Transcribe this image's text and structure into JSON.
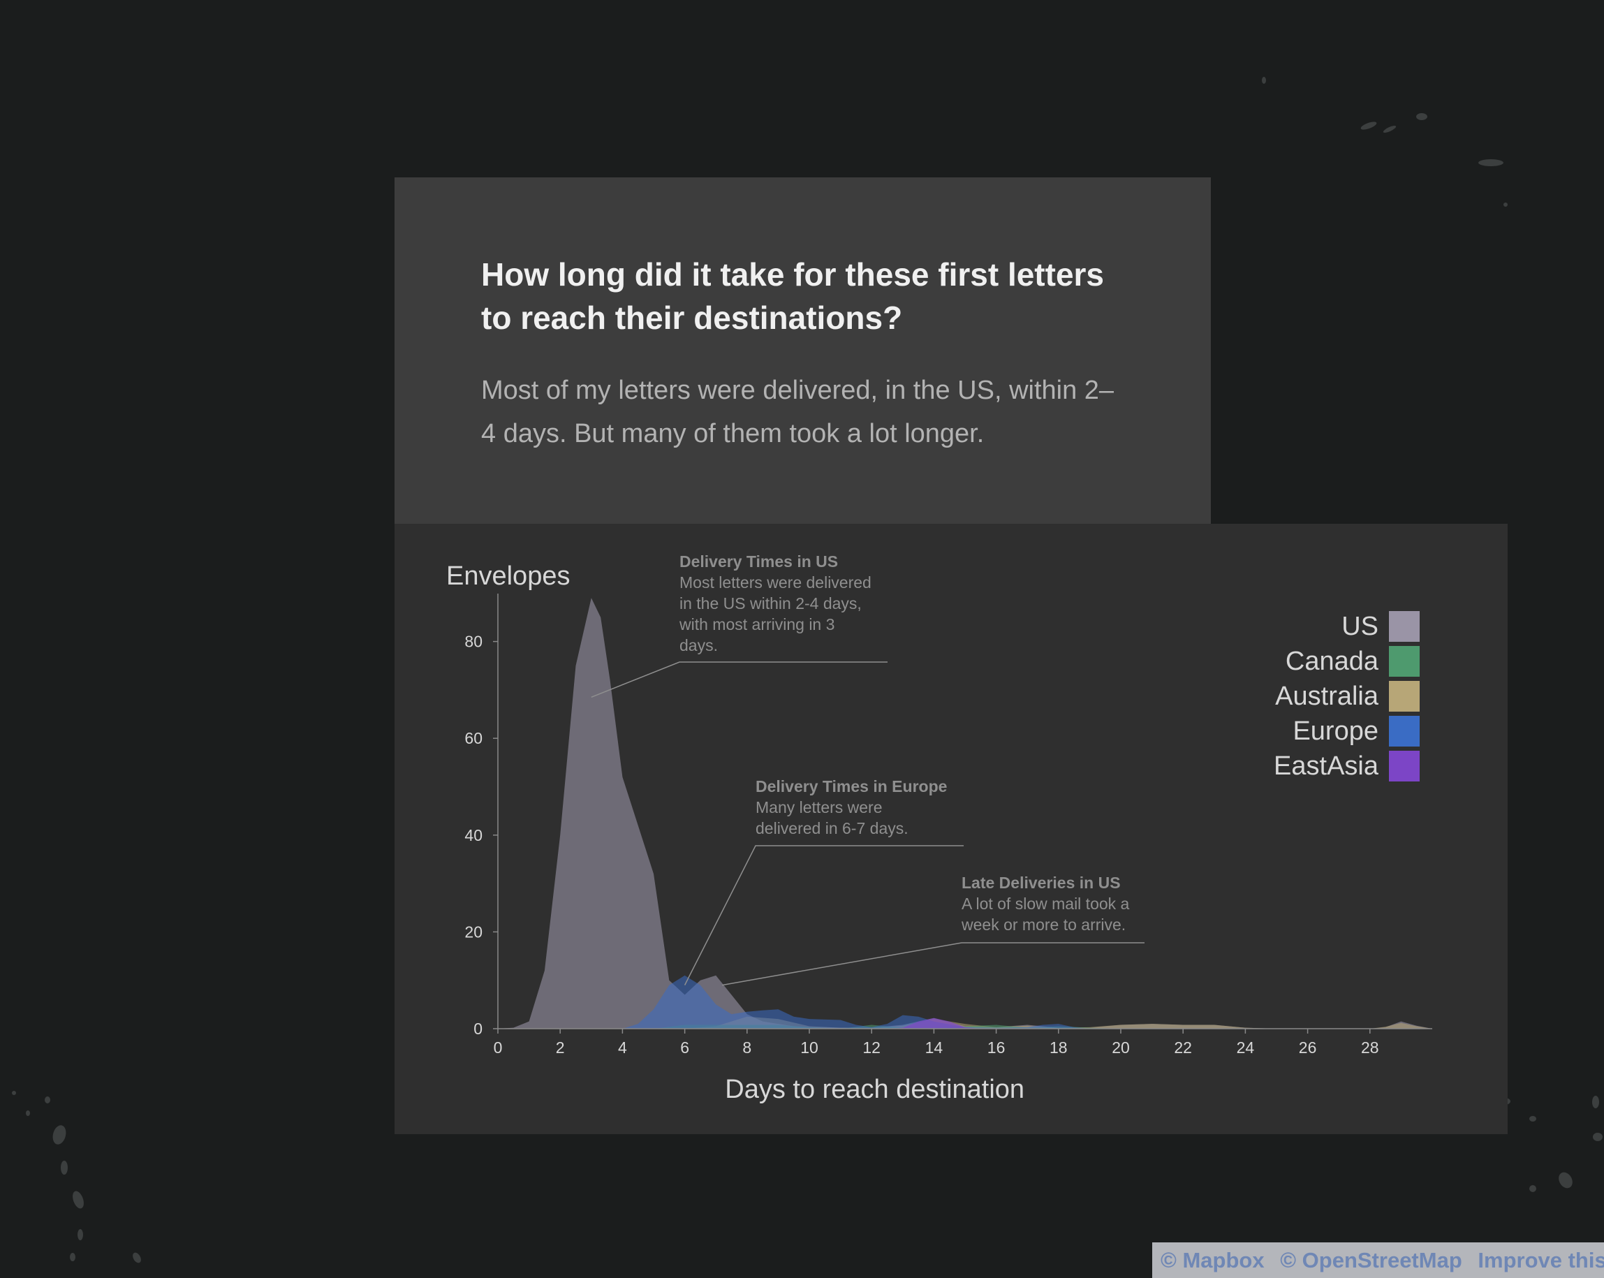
{
  "intro": {
    "title": "How long did it take for these first letters to reach their destinations?",
    "text": "Most of my letters were delivered, in the US, within 2–4 days. But many of them took a lot longer."
  },
  "attribution": {
    "mapbox": "© Mapbox",
    "osm": "© OpenStreetMap",
    "improve": "Improve this m"
  },
  "chart_data": {
    "type": "area",
    "ylabel": "Envelopes",
    "xlabel": "Days to reach destination",
    "xlim": [
      0,
      30
    ],
    "ylim": [
      0,
      90
    ],
    "xticks": [
      0,
      2,
      4,
      6,
      8,
      10,
      12,
      14,
      16,
      18,
      20,
      22,
      24,
      26,
      28
    ],
    "yticks": [
      0,
      20,
      40,
      60,
      80
    ],
    "legend_position": "top-right",
    "series": [
      {
        "name": "US",
        "color": "#9a94a6",
        "x": [
          0,
          0.5,
          1,
          1.5,
          2,
          2.5,
          3,
          3.3,
          3.6,
          4,
          4.5,
          5,
          5.5,
          6,
          6.5,
          7,
          7.5,
          8,
          8.5,
          9,
          9.5,
          10,
          11,
          12,
          13,
          14,
          15,
          16,
          17,
          18,
          19,
          20,
          21,
          22,
          23,
          24,
          25,
          26,
          27,
          28,
          28.5,
          29,
          29.5,
          30
        ],
        "y": [
          0,
          0.2,
          1.5,
          12,
          40,
          75,
          89,
          85,
          72,
          52,
          42,
          32,
          10,
          7,
          10,
          11,
          7,
          3,
          1.5,
          1,
          0.5,
          0.3,
          0.2,
          0.2,
          0.8,
          2.2,
          0.5,
          0.3,
          0.8,
          0.2,
          0.2,
          0.8,
          1,
          0.8,
          0.8,
          0.2,
          0,
          0,
          0,
          0,
          0.3,
          1.5,
          0.6,
          0
        ]
      },
      {
        "name": "Canada",
        "color": "#4e9a6e",
        "x": [
          0,
          5,
          6,
          7,
          8,
          9,
          10,
          11,
          12,
          13,
          14,
          15,
          16,
          17,
          18,
          19,
          20,
          30
        ],
        "y": [
          0,
          0,
          0.8,
          0.8,
          0.8,
          0.8,
          0.3,
          0,
          0.8,
          0.2,
          0.2,
          0.5,
          0.8,
          0.2,
          0.5,
          0.2,
          0,
          0
        ]
      },
      {
        "name": "Australia",
        "color": "#b7a677",
        "x": [
          0,
          6,
          7,
          8,
          9,
          10,
          11,
          12,
          13,
          14,
          15,
          16,
          17,
          18,
          19,
          20,
          21,
          22,
          23,
          24,
          25,
          28,
          28.5,
          29,
          29.5,
          30
        ],
        "y": [
          0,
          0,
          0.5,
          2.5,
          2,
          0.5,
          0.2,
          0.2,
          0.6,
          2,
          1,
          0.3,
          0.6,
          0.2,
          0.3,
          0.8,
          1,
          0.8,
          0.8,
          0.2,
          0,
          0,
          0.4,
          1.2,
          0.5,
          0
        ]
      },
      {
        "name": "Europe",
        "color": "#3a6cc4",
        "x": [
          0,
          4,
          4.5,
          5,
          5.5,
          6,
          6.5,
          7,
          7.5,
          8,
          8.5,
          9,
          9.5,
          10,
          11,
          11.5,
          12,
          12.5,
          13,
          13.5,
          14,
          15,
          16,
          17,
          17.5,
          18,
          18.5,
          19,
          30
        ],
        "y": [
          0,
          0,
          1,
          4,
          9,
          11,
          9,
          5,
          3,
          3.5,
          3.8,
          4,
          2.5,
          2,
          1.8,
          0.8,
          0.3,
          1,
          2.8,
          2.5,
          1.5,
          0.3,
          0.2,
          0.3,
          0.8,
          1,
          0.3,
          0,
          0
        ]
      },
      {
        "name": "EastAsia",
        "color": "#7c45c6",
        "x": [
          0,
          12.5,
          13,
          13.5,
          14,
          14.5,
          15,
          15.5,
          30
        ],
        "y": [
          0,
          0,
          0.2,
          1.5,
          2.2,
          1.5,
          0.3,
          0,
          0
        ]
      }
    ],
    "annotations": [
      {
        "title": "Delivery Times in US",
        "lines": [
          "Most letters were delivered",
          "in the US within 2-4 days,",
          "with most arriving in 3",
          "days."
        ]
      },
      {
        "title": "Delivery Times in Europe",
        "lines": [
          "Many letters were",
          "delivered in 6-7 days."
        ]
      },
      {
        "title": "Late Deliveries in US",
        "lines": [
          "A lot of slow mail took a",
          "week or more to arrive."
        ]
      }
    ]
  }
}
